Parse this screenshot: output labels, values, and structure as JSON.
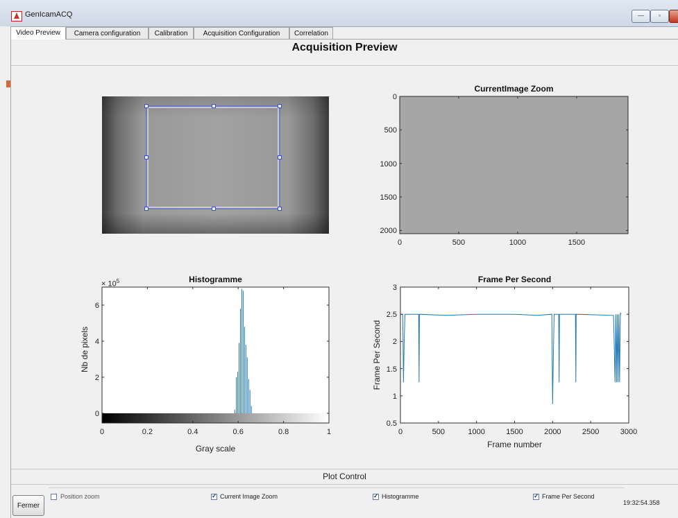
{
  "window": {
    "title": "GenIcamACQ",
    "minimize_label": "—",
    "maximize_label": "▫"
  },
  "tabs": [
    {
      "label": "Video Preview",
      "active": true
    },
    {
      "label": "Camera configuration",
      "active": false
    },
    {
      "label": "Calibration",
      "active": false
    },
    {
      "label": "Acquisition Configuration",
      "active": false
    },
    {
      "label": "Correlation",
      "active": false
    }
  ],
  "page": {
    "title": "Acquisition Preview"
  },
  "preview": {
    "roi": "selection rectangle"
  },
  "zoom_plot": {
    "title": "CurrentImage Zoom",
    "x_ticks": [
      "0",
      "500",
      "1000",
      "1500"
    ],
    "y_ticks": [
      "0",
      "500",
      "1000",
      "1500",
      "2000"
    ]
  },
  "hist_plot": {
    "title": "Histogramme",
    "multiplier": "× 10",
    "exponent": "5",
    "xlabel": "Gray scale",
    "ylabel": "Nb de pixels",
    "x_ticks": [
      "0",
      "0.2",
      "0.4",
      "0.6",
      "0.8",
      "1"
    ],
    "y_ticks": [
      "0",
      "2",
      "4",
      "6"
    ]
  },
  "fps_plot": {
    "title": "Frame Per Second",
    "xlabel": "Frame number",
    "ylabel": "Frame Per Second",
    "x_ticks": [
      "0",
      "500",
      "1000",
      "1500",
      "2000",
      "2500",
      "3000"
    ],
    "y_ticks": [
      "0.5",
      "1",
      "1.5",
      "2",
      "2.5",
      "3"
    ]
  },
  "chart_data": [
    {
      "type": "bar",
      "title": "Histogramme",
      "xlabel": "Gray scale",
      "ylabel": "Nb de pixels",
      "xlim": [
        0,
        1
      ],
      "ylim": [
        0,
        700000
      ],
      "x": [
        0.585,
        0.592,
        0.598,
        0.604,
        0.61,
        0.616,
        0.622,
        0.628,
        0.634,
        0.64,
        0.646,
        0.652,
        0.658
      ],
      "values": [
        20000,
        200000,
        230000,
        390000,
        580000,
        690000,
        680000,
        480000,
        380000,
        310000,
        190000,
        130000,
        40000
      ]
    },
    {
      "type": "line",
      "title": "Frame Per Second",
      "xlabel": "Frame number",
      "ylabel": "Frame Per Second",
      "xlim": [
        0,
        3000
      ],
      "ylim": [
        0.5,
        3
      ],
      "x": [
        0,
        30,
        40,
        50,
        60,
        240,
        245,
        250,
        600,
        1000,
        1500,
        1800,
        1990,
        2000,
        2010,
        2020,
        2080,
        2085,
        2090,
        2300,
        2305,
        2310,
        2800,
        2820,
        2830,
        2840,
        2850,
        2860,
        2870,
        2880,
        2890,
        2900
      ],
      "values": [
        2.5,
        2.5,
        1.25,
        2.05,
        2.5,
        2.5,
        1.25,
        2.5,
        2.48,
        2.5,
        2.5,
        2.48,
        2.5,
        0.85,
        1.75,
        2.5,
        2.5,
        1.25,
        2.5,
        2.5,
        1.25,
        2.5,
        2.48,
        1.25,
        2.5,
        1.25,
        2.5,
        1.25,
        2.5,
        1.25,
        2.52,
        2.5
      ]
    }
  ],
  "plot_control": {
    "title": "Plot Control",
    "position_zoom": {
      "label": "Position zoom",
      "checked": false
    },
    "current_image_zoom": {
      "label": "Current Image Zoom",
      "checked": true
    },
    "histogramme": {
      "label": "Histogramme",
      "checked": true
    },
    "frame_per_second": {
      "label": "Frame Per Second",
      "checked": true
    }
  },
  "footer": {
    "close_label": "Fermer",
    "time": "19:32:54.358"
  }
}
